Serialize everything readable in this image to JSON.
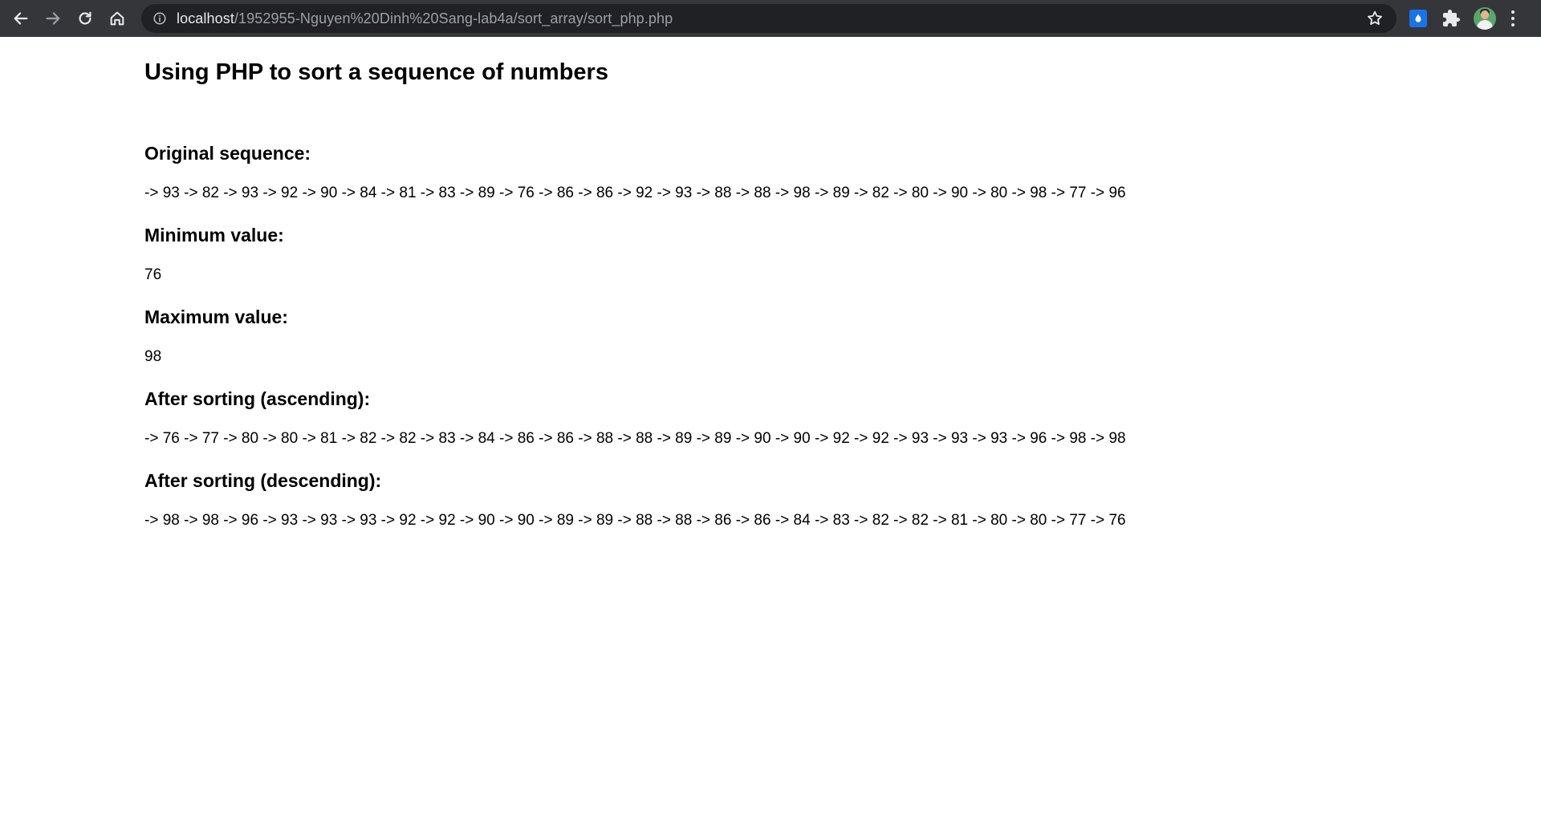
{
  "browser": {
    "url_host": "localhost",
    "url_path": "/1952955-Nguyen%20Dinh%20Sang-lab4a/sort_array/sort_php.php"
  },
  "page": {
    "title": "Using PHP to sort a sequence of numbers",
    "original": {
      "heading": "Original sequence:",
      "value": "-> 93 -> 82 -> 93 -> 92 -> 90 -> 84 -> 81 -> 83 -> 89 -> 76 -> 86 -> 86 -> 92 -> 93 -> 88 -> 88 -> 98 -> 89 -> 82 -> 80 -> 90 -> 80 -> 98 -> 77 -> 96"
    },
    "minimum": {
      "heading": "Minimum value:",
      "value": "76"
    },
    "maximum": {
      "heading": "Maximum value:",
      "value": "98"
    },
    "ascending": {
      "heading": "After sorting (ascending):",
      "value": "-> 76 -> 77 -> 80 -> 80 -> 81 -> 82 -> 82 -> 83 -> 84 -> 86 -> 86 -> 88 -> 88 -> 89 -> 89 -> 90 -> 90 -> 92 -> 92 -> 93 -> 93 -> 93 -> 96 -> 98 -> 98"
    },
    "descending": {
      "heading": "After sorting (descending):",
      "value": "-> 98 -> 98 -> 96 -> 93 -> 93 -> 93 -> 92 -> 92 -> 90 -> 90 -> 89 -> 89 -> 88 -> 88 -> 86 -> 86 -> 84 -> 83 -> 82 -> 82 -> 81 -> 80 -> 80 -> 77 -> 76"
    }
  },
  "icons": {
    "back": "back-arrow-icon",
    "forward": "forward-arrow-icon",
    "reload": "reload-icon",
    "home": "home-icon",
    "info": "info-icon",
    "bookmark": "star-icon",
    "extension": "water-drop-icon",
    "extensions_menu": "puzzle-icon",
    "profile": "avatar",
    "menu": "kebab-menu-icon"
  },
  "colors": {
    "toolbar_bg": "#35363a",
    "omnibox_bg": "#202124",
    "page_bg": "#ffffff",
    "text": "#000000"
  }
}
